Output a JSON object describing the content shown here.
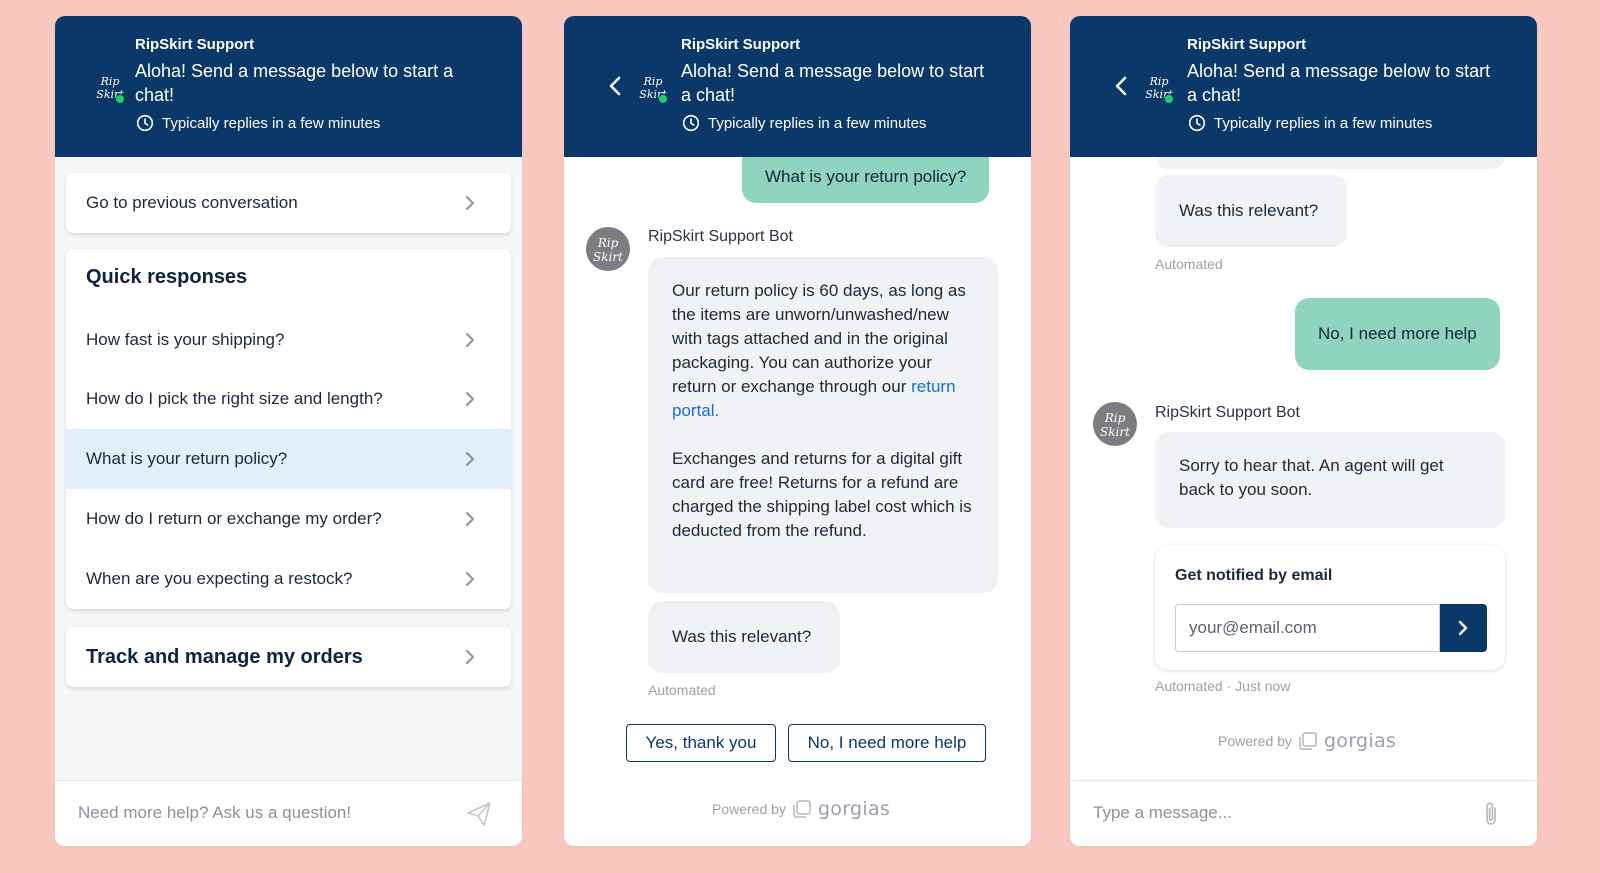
{
  "colors": {
    "background": "#F9C9C1",
    "header": "#0A3868",
    "user_bubble": "#8ED4BF",
    "bot_bubble": "#F1F2F5",
    "link": "#1E6AD8",
    "online": "#1FCF6A"
  },
  "header": {
    "brand": "RipSkirt Support",
    "greeting_p1": "Aloha! Send a message below to start a chat!",
    "greeting_p2_line1": "Aloha! Send a message below to start",
    "greeting_p2_line2": "a chat!",
    "reply_time": "Typically replies in a few minutes",
    "logo_text": "Rip Skirt"
  },
  "panel1": {
    "previous_conversation": "Go to previous conversation",
    "quick_responses_title": "Quick responses",
    "quick_responses": [
      "How fast is your shipping?",
      "How do I pick the right size and length?",
      "What is your return policy?",
      "How do I return or exchange my order?",
      "When are you expecting a restock?"
    ],
    "track_orders": "Track and manage my orders",
    "input_placeholder": "Need more help? Ask us a question!"
  },
  "panel2": {
    "user_message": "What is your return policy?",
    "bot_name": "RipSkirt Support Bot",
    "bot_message_para1": "Our return policy is 60 days, as long as the items are unworn/unwashed/new with tags attached and in the original packaging. You can authorize your return or exchange through our",
    "bot_message_link": "return portal",
    "bot_message_para2": "Exchanges and returns for a digital gift card are free! Returns for a refund are charged the shipping label cost which is deducted from the refund.",
    "relevance_question": "Was this relevant?",
    "automated_label": "Automated",
    "yes_button": "Yes, thank you",
    "no_button": "No, I need more help",
    "powered_by": "Powered by",
    "powered_brand": "gorgias"
  },
  "panel3": {
    "relevance_question": "Was this relevant?",
    "automated_label": "Automated",
    "user_message": "No, I need more help",
    "bot_name": "RipSkirt Support Bot",
    "bot_reply": "Sorry to hear that. An agent will get back to you soon.",
    "email_title": "Get notified by email",
    "email_placeholder": "your@email.com",
    "email_meta": "Automated · Just now",
    "powered_by": "Powered by",
    "powered_brand": "gorgias",
    "input_placeholder": "Type a message..."
  }
}
